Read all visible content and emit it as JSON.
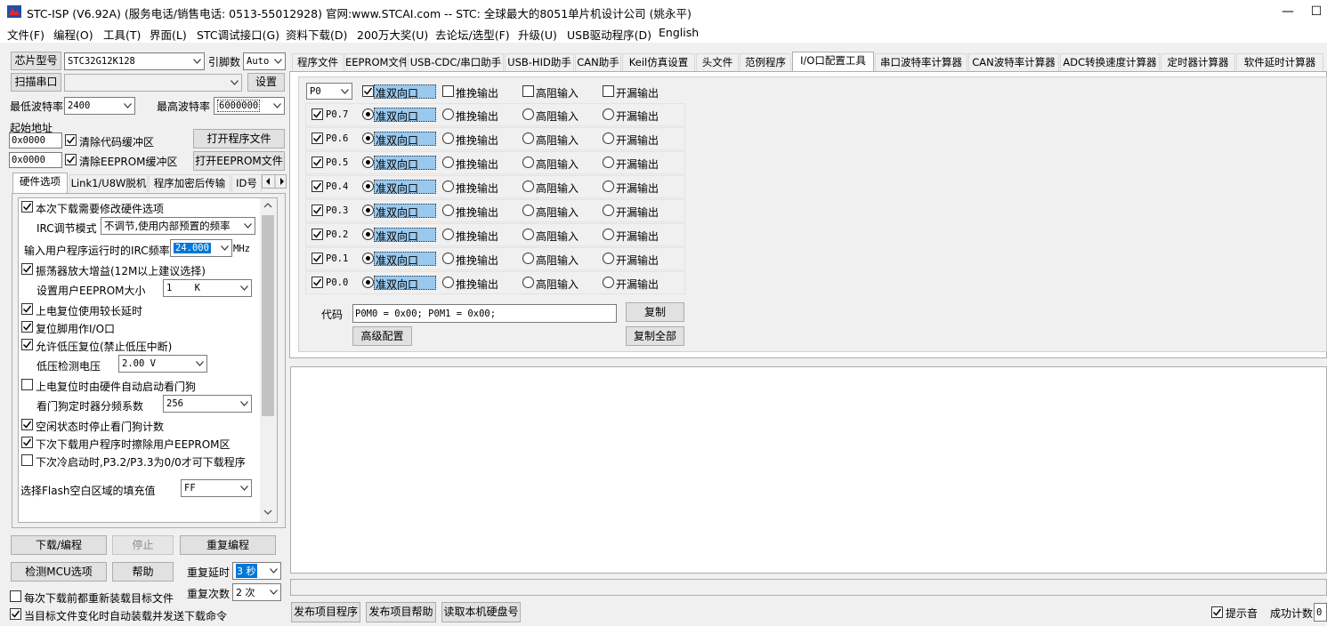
{
  "window": {
    "title": "STC-ISP (V6.92A) (服务电话/销售电话: 0513-55012928) 官网:www.STCAI.com  -- STC: 全球最大的8051单片机设计公司 (姚永平)",
    "minimize": "—",
    "maximize": "☐"
  },
  "menu": [
    "文件(F)",
    "编程(O)",
    "工具(T)",
    "界面(L)",
    "STC调试接口(G)",
    "资料下载(D)",
    "200万大奖(U)",
    "去论坛/选型(F)",
    "升级(U)",
    "USB驱动程序(D)",
    "English"
  ],
  "left": {
    "chip_label": "芯片型号",
    "chip_value": "STC32G12K128",
    "engine_label": "引脚数",
    "engine_value": "Auto",
    "scan_label": "扫描串口",
    "scan_value": "",
    "settings_btn": "设置",
    "min_baud_label": "最低波特率",
    "min_baud_value": "2400",
    "max_baud_label": "最高波特率",
    "max_baud_value": "6000000",
    "start_addr_label": "起始地址",
    "addr1": "0x0000",
    "clear_code": "清除代码缓冲区",
    "open_prog": "打开程序文件",
    "addr2": "0x0000",
    "clear_eeprom": "清除EEPROM缓冲区",
    "open_eeprom": "打开EEPROM文件",
    "tabs": [
      "硬件选项",
      "Link1/U8W脱机",
      "程序加密后传输",
      "ID号"
    ],
    "hw": {
      "opt1": "本次下载需要修改硬件选项",
      "irc_mode_label": "IRC调节模式",
      "irc_mode_value": "不调节,使用内部预置的频率",
      "irc_freq_label": "输入用户程序运行时的IRC频率",
      "irc_freq_value": "24.000",
      "irc_unit": "MHz",
      "opt2": "振荡器放大增益(12M以上建议选择)",
      "eeprom_size_label": "设置用户EEPROM大小",
      "eeprom_size_value": "1    K",
      "opt3": "上电复位使用较长延时",
      "opt4": "复位脚用作I/O口",
      "opt5": "允许低压复位(禁止低压中断)",
      "lvd_label": "低压检测电压",
      "lvd_value": "2.00 V",
      "opt6": "上电复位时由硬件自动启动看门狗",
      "wdt_label": "看门狗定时器分频系数",
      "wdt_value": "256",
      "opt7": "空闲状态时停止看门狗计数",
      "opt8": "下次下载用户程序时擦除用户EEPROM区",
      "opt9": "下次冷启动时,P3.2/P3.3为0/0才可下载程序",
      "fill_label": "选择Flash空白区域的填充值",
      "fill_value": "FF"
    },
    "download_btn": "下载/编程",
    "stop_btn": "停止",
    "reprog_btn": "重复编程",
    "check_btn": "检测MCU选项",
    "help_btn": "帮助",
    "repeat_delay_label": "重复延时",
    "repeat_delay_value": "3 秒",
    "repeat_count_label": "重复次数",
    "repeat_count_value": "2 次",
    "reload_each": "每次下载前都重新装载目标文件",
    "auto_reload": "当目标文件变化时自动装载并发送下载命令"
  },
  "right": {
    "tabs": [
      "程序文件",
      "EEPROM文件",
      "USB-CDC/串口助手",
      "USB-HID助手",
      "CAN助手",
      "Keil仿真设置",
      "头文件",
      "范例程序",
      "I/O口配置工具",
      "串口波特率计算器",
      "CAN波特率计算器",
      "ADC转换速度计算器",
      "定时器计算器",
      "软件延时计算器"
    ],
    "port_value": "P0",
    "modes": [
      "准双向口",
      "推挽输出",
      "高阻输入",
      "开漏输出"
    ],
    "pins": [
      "P0.7",
      "P0.6",
      "P0.5",
      "P0.4",
      "P0.3",
      "P0.2",
      "P0.1",
      "P0.0"
    ],
    "code_label": "代码",
    "code_value": "P0M0 = 0x00; P0M1 = 0x00;",
    "copy_btn": "复制",
    "advanced_btn": "高级配置",
    "copy_all_btn": "复制全部"
  },
  "bottom": {
    "publish_prog": "发布项目程序",
    "publish_help": "发布项目帮助",
    "read_disk": "读取本机硬盘号",
    "beep_label": "提示音",
    "success_label": "成功计数",
    "success_value": "0"
  }
}
